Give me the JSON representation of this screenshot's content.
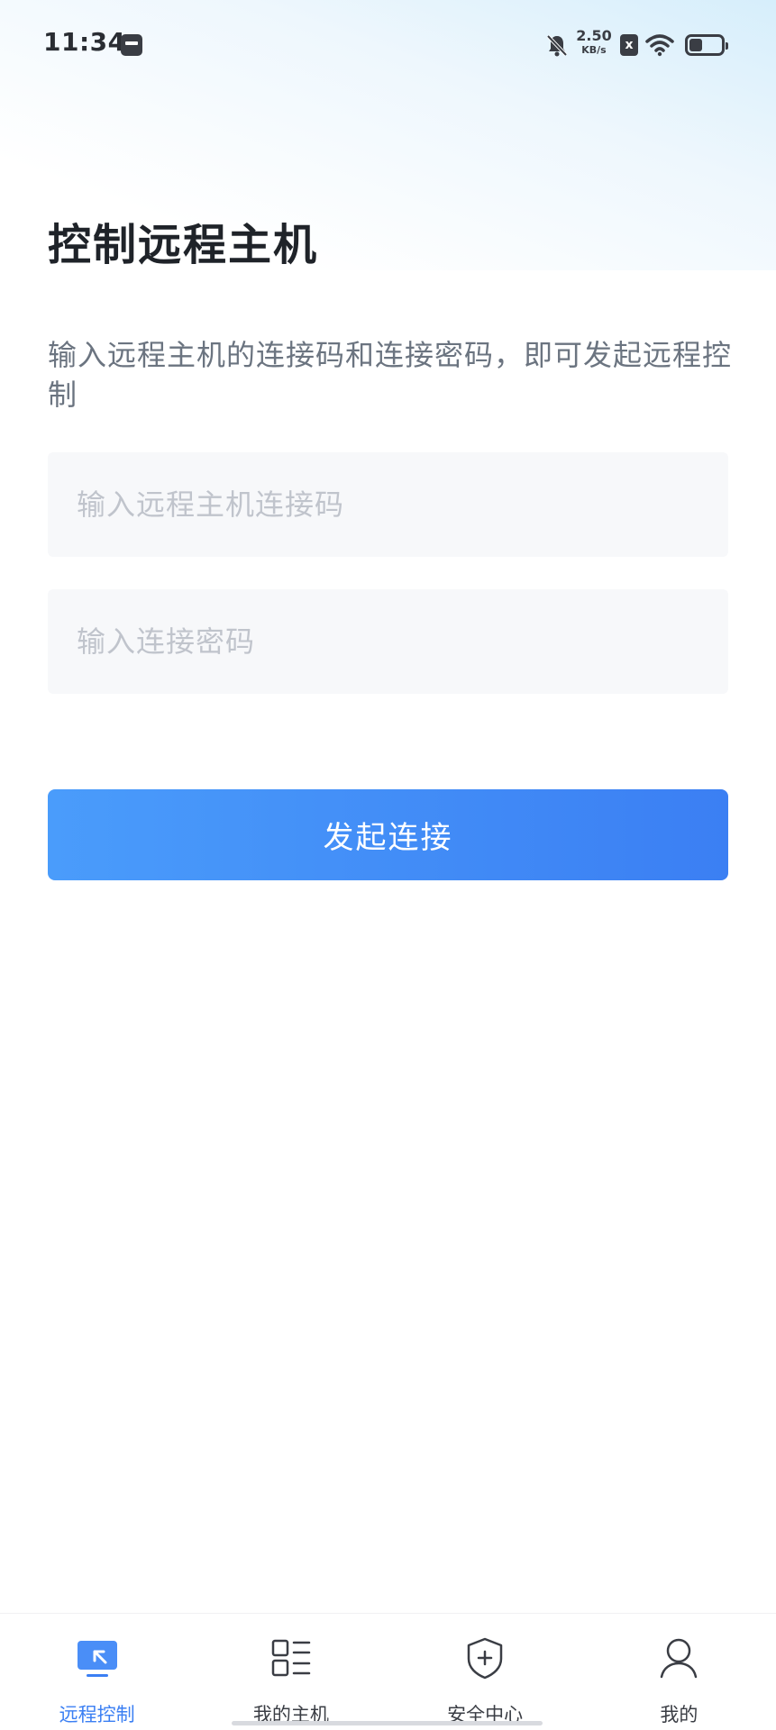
{
  "status_bar": {
    "time": "11:34",
    "net_speed_value": "2.50",
    "net_speed_unit": "KB/s",
    "sim_label": "x",
    "icons": [
      "notification-icon",
      "mute-bell-icon",
      "sim-icon",
      "wifi-icon",
      "battery-icon"
    ]
  },
  "main": {
    "title": "控制远程主机",
    "description": "输入远程主机的连接码和连接密码，即可发起远程控制",
    "code_input": {
      "placeholder": "输入远程主机连接码",
      "value": ""
    },
    "password_input": {
      "placeholder": "输入连接密码",
      "value": ""
    },
    "connect_button": "发起连接"
  },
  "tab_bar": {
    "active": "远程控制",
    "tabs": [
      {
        "label": "远程控制",
        "icon": "remote-desktop-icon",
        "active": true
      },
      {
        "label": "我的主机",
        "icon": "host-list-icon",
        "active": false
      },
      {
        "label": "安全中心",
        "icon": "shield-plus-icon",
        "active": false
      },
      {
        "label": "我的",
        "icon": "user-icon",
        "active": false
      }
    ]
  },
  "colors": {
    "accent": "#3b7ff3",
    "accent_light": "#4a9cfb",
    "title_text": "#1f2329",
    "secondary_text": "#6b7480",
    "placeholder_text": "#c0c4cc",
    "input_background": "#f7f8fa"
  }
}
